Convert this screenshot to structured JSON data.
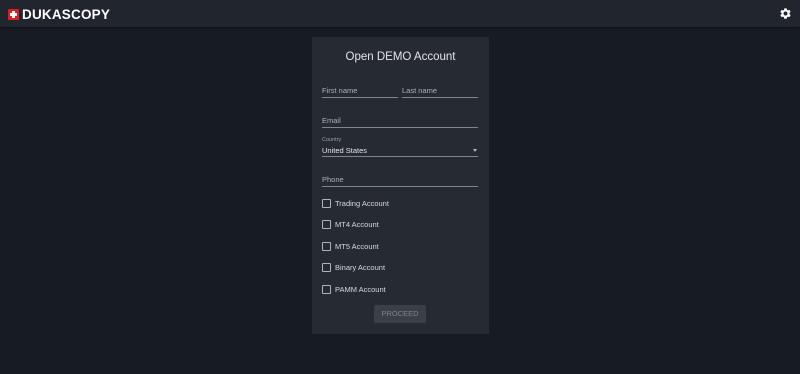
{
  "header": {
    "brand": "DUKASCOPY",
    "logo_icon": "swiss-flag-icon",
    "settings_icon": "gear-icon"
  },
  "form": {
    "title": "Open DEMO Account",
    "first_name_placeholder": "First name",
    "last_name_placeholder": "Last name",
    "email_placeholder": "Email",
    "country_label": "Country",
    "country_value": "United States",
    "phone_placeholder": "Phone",
    "accounts": [
      {
        "label": "Trading Account",
        "checked": false
      },
      {
        "label": "MT4 Account",
        "checked": false
      },
      {
        "label": "MT5 Account",
        "checked": false
      },
      {
        "label": "Binary Account",
        "checked": false
      },
      {
        "label": "PAMM Account",
        "checked": false
      }
    ],
    "proceed_label": "PROCEED",
    "proceed_disabled": true
  },
  "colors": {
    "background": "#171b23",
    "topbar": "#21252d",
    "card": "#262a32",
    "brand_red": "#e01b22"
  }
}
